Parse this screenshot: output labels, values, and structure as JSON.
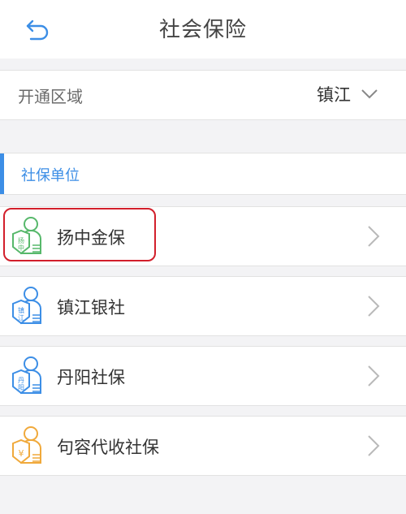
{
  "header": {
    "title": "社会保险",
    "back_icon": "back-arrow-icon"
  },
  "region": {
    "label": "开通区域",
    "value": "镇江",
    "dropdown_icon": "chevron-down-icon"
  },
  "section": {
    "title": "社保单位",
    "accent_color": "#3c8ee6"
  },
  "units": [
    {
      "name": "扬中金保",
      "icon_text": "扬中",
      "icon_color": "#57b86b",
      "icon": "insurance-person-icon"
    },
    {
      "name": "镇江银社",
      "icon_text": "镇江",
      "icon_color": "#3c8ee6",
      "icon": "insurance-person-icon"
    },
    {
      "name": "丹阳社保",
      "icon_text": "丹阳",
      "icon_color": "#3c8ee6",
      "icon": "insurance-person-icon"
    },
    {
      "name": "句容代收社保",
      "icon_text": "¥",
      "icon_color": "#f0a93b",
      "icon": "insurance-person-icon"
    }
  ],
  "highlight_color": "#d21f2b"
}
